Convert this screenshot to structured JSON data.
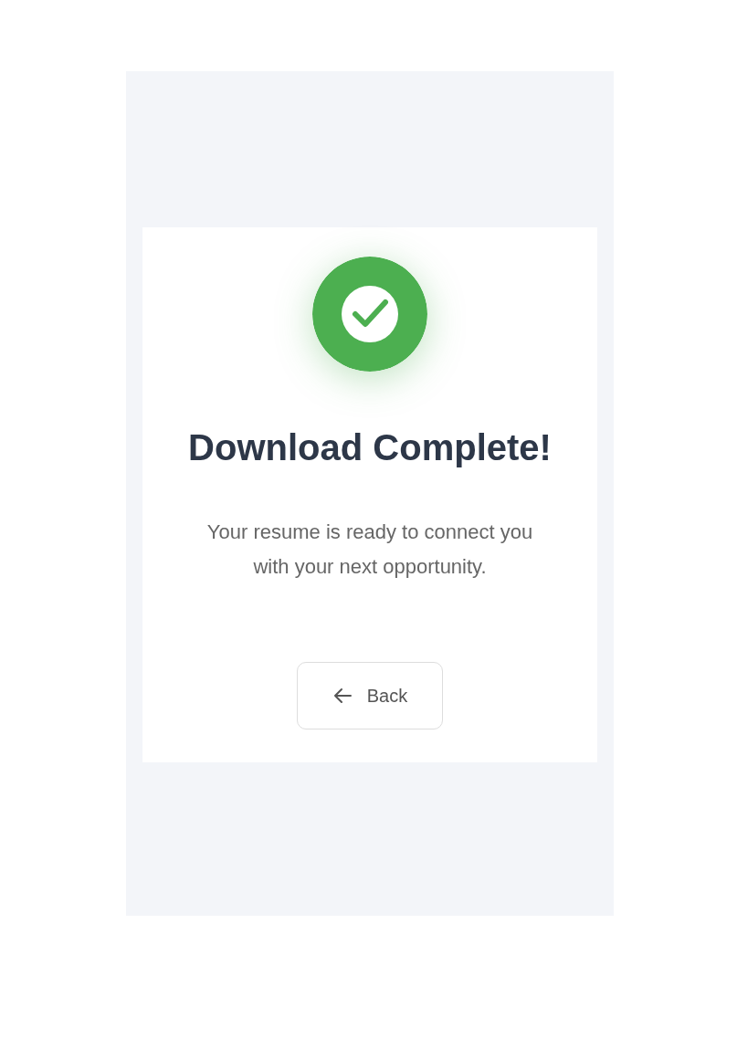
{
  "title": "Download Complete!",
  "message": "Your resume is ready to connect you with your next opportunity.",
  "button": {
    "label": "Back"
  }
}
